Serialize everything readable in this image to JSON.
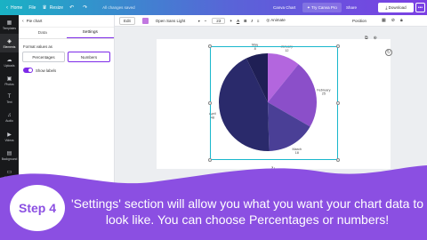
{
  "topbar": {
    "home": "Home",
    "file": "File",
    "resize": "Resize",
    "status": "All changes saved",
    "title": "Canva Chart",
    "try_pro": "Try Canva Pro",
    "share": "Share",
    "download": "Download",
    "more": "•••"
  },
  "rail": [
    {
      "label": "Templates",
      "icon": "layout-icon"
    },
    {
      "label": "Elements",
      "icon": "shapes-icon"
    },
    {
      "label": "Uploads",
      "icon": "cloud-upload-icon"
    },
    {
      "label": "Photos",
      "icon": "image-icon"
    },
    {
      "label": "Text",
      "icon": "text-icon"
    },
    {
      "label": "Audio",
      "icon": "music-icon"
    },
    {
      "label": "Videos",
      "icon": "video-icon"
    },
    {
      "label": "Background",
      "icon": "pattern-icon"
    },
    {
      "label": "Folders",
      "icon": "folder-icon"
    }
  ],
  "panel": {
    "title": "Pie chart",
    "tab_data": "Data",
    "tab_settings": "Settings",
    "format_label": "Format values as",
    "opt_percentages": "Percentages",
    "opt_numbers": "Numbers",
    "show_labels": "Show labels"
  },
  "toolbar": {
    "edit": "Edit",
    "color": "#c177e0",
    "font": "Open Sans Light",
    "size": "23",
    "bold": "B",
    "italic": "I",
    "animate": "Animate",
    "position": "Position"
  },
  "chart_data": {
    "type": "pie",
    "categories": [
      "January",
      "February",
      "March",
      "April",
      "May"
    ],
    "values": [
      12,
      25,
      18,
      48,
      8
    ],
    "colors": [
      "#b366de",
      "#8b4fc9",
      "#4a3f96",
      "#2a2a6b",
      "#1f1f55"
    ],
    "show_labels": true,
    "value_format": "Numbers"
  },
  "banner": {
    "step": "Step 4",
    "text": "'Settings' section will allow you what you want your chart data to look like. You can choose Percentages or numbers!"
  }
}
